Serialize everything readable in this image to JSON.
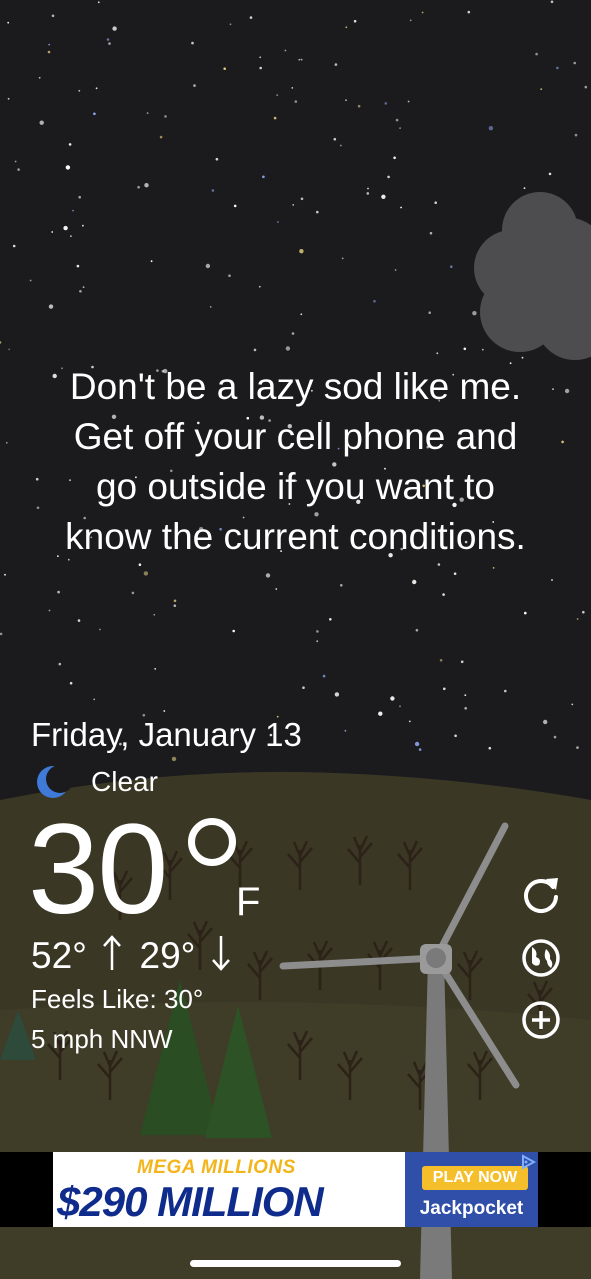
{
  "quote": {
    "line1": "Don't be a lazy sod like me.",
    "line2": "Get off your cell phone and",
    "line3": "go outside if you want to",
    "line4": "know the current conditions."
  },
  "weather": {
    "date": "Friday, January 13",
    "condition_icon": "crescent-moon-icon",
    "condition": "Clear",
    "temperature": "30",
    "unit": "F",
    "high": "52°",
    "low": "29°",
    "feels_like": "Feels Like: 30°",
    "wind": "5 mph NNW"
  },
  "side_buttons": [
    {
      "icon": "refresh-icon"
    },
    {
      "icon": "globe-icon"
    },
    {
      "icon": "add-icon"
    }
  ],
  "ad": {
    "small_text": "MEGA MILLIONS",
    "amount": "$290 MILLION",
    "cta": "PLAY NOW",
    "brand": "Jackpocket",
    "adchoices_icon": "adchoices-icon"
  },
  "colors": {
    "sky": "#1b1b1d",
    "hill": "#3b3826",
    "moon": "#3f7ad8",
    "ad_blue": "#2f4fa8",
    "ad_yellow": "#f4bf2a"
  }
}
